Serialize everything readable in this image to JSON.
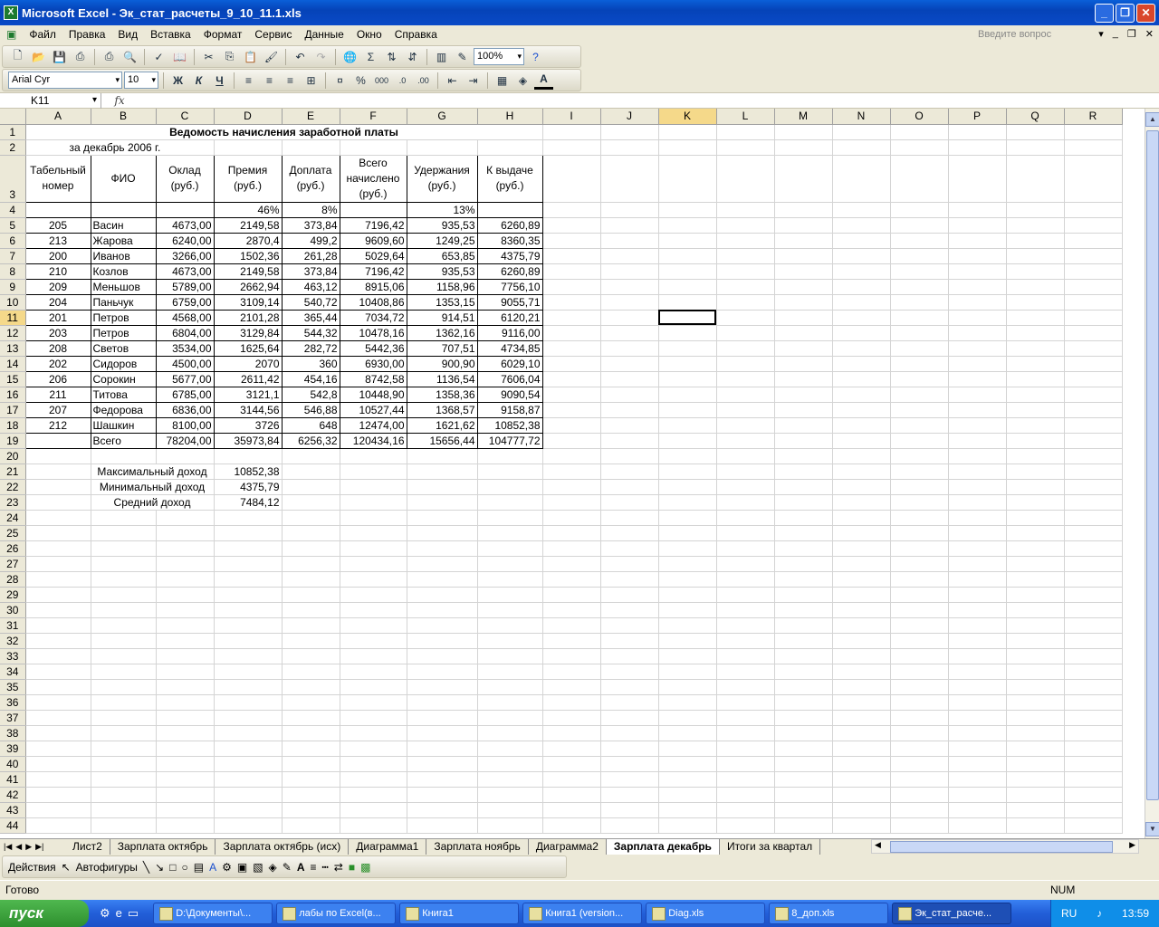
{
  "window": {
    "title": "Microsoft Excel - Эк_стат_расчеты_9_10_11.1.xls"
  },
  "menu": [
    "Файл",
    "Правка",
    "Вид",
    "Вставка",
    "Формат",
    "Сервис",
    "Данные",
    "Окно",
    "Справка"
  ],
  "ask_placeholder": "Введите вопрос",
  "toolbar": {
    "zoom": "100%",
    "font": "Arial Cyr",
    "size": "10",
    "bold": "Ж",
    "italic": "К",
    "underline": "Ч",
    "percent": "%",
    "thousands": "000"
  },
  "formula": {
    "cell_ref": "K11",
    "fx": "fx",
    "content": ""
  },
  "columns": [
    "A",
    "B",
    "C",
    "D",
    "E",
    "F",
    "G",
    "H",
    "I",
    "J",
    "K",
    "L",
    "M",
    "N",
    "O",
    "P",
    "Q",
    "R"
  ],
  "sheet": {
    "title": "Ведомость начисления заработной платы",
    "subtitle": "за декабрь 2006 г.",
    "headers": [
      "Табельный номер",
      "ФИО",
      "Оклад (руб.)",
      "Премия (руб.)",
      "Доплата (руб.)",
      "Всего начислено (руб.)",
      "Удержания (руб.)",
      "К выдаче (руб.)"
    ],
    "rates": {
      "bonus": "46%",
      "extra": "8%",
      "deduct": "13%"
    },
    "rows": [
      [
        "205",
        "Васин",
        "4673,00",
        "2149,58",
        "373,84",
        "7196,42",
        "935,53",
        "6260,89"
      ],
      [
        "213",
        "Жарова",
        "6240,00",
        "2870,4",
        "499,2",
        "9609,60",
        "1249,25",
        "8360,35"
      ],
      [
        "200",
        "Иванов",
        "3266,00",
        "1502,36",
        "261,28",
        "5029,64",
        "653,85",
        "4375,79"
      ],
      [
        "210",
        "Козлов",
        "4673,00",
        "2149,58",
        "373,84",
        "7196,42",
        "935,53",
        "6260,89"
      ],
      [
        "209",
        "Меньшов",
        "5789,00",
        "2662,94",
        "463,12",
        "8915,06",
        "1158,96",
        "7756,10"
      ],
      [
        "204",
        "Паньчук",
        "6759,00",
        "3109,14",
        "540,72",
        "10408,86",
        "1353,15",
        "9055,71"
      ],
      [
        "201",
        "Петров",
        "4568,00",
        "2101,28",
        "365,44",
        "7034,72",
        "914,51",
        "6120,21"
      ],
      [
        "203",
        "Петров",
        "6804,00",
        "3129,84",
        "544,32",
        "10478,16",
        "1362,16",
        "9116,00"
      ],
      [
        "208",
        "Светов",
        "3534,00",
        "1625,64",
        "282,72",
        "5442,36",
        "707,51",
        "4734,85"
      ],
      [
        "202",
        "Сидоров",
        "4500,00",
        "2070",
        "360",
        "6930,00",
        "900,90",
        "6029,10"
      ],
      [
        "206",
        "Сорокин",
        "5677,00",
        "2611,42",
        "454,16",
        "8742,58",
        "1136,54",
        "7606,04"
      ],
      [
        "211",
        "Титова",
        "6785,00",
        "3121,1",
        "542,8",
        "10448,90",
        "1358,36",
        "9090,54"
      ],
      [
        "207",
        "Федорова",
        "6836,00",
        "3144,56",
        "546,88",
        "10527,44",
        "1368,57",
        "9158,87"
      ],
      [
        "212",
        "Шашкин",
        "8100,00",
        "3726",
        "648",
        "12474,00",
        "1621,62",
        "10852,38"
      ]
    ],
    "total": [
      "Всего",
      "78204,00",
      "35973,84",
      "6256,32",
      "120434,16",
      "15656,44",
      "104777,72"
    ],
    "stats": [
      {
        "label": "Максимальный доход",
        "value": "10852,38"
      },
      {
        "label": "Минимальный доход",
        "value": "4375,79"
      },
      {
        "label": "Средний доход",
        "value": "7484,12"
      }
    ]
  },
  "tabs": [
    "Лист2",
    "Зарплата октябрь",
    "Зарплата октябрь (исх)",
    "Диаграмма1",
    "Зарплата ноябрь",
    "Диаграмма2",
    "Зарплата декабрь",
    "Итоги за квартал"
  ],
  "active_tab": "Зарплата декабрь",
  "drawbar": {
    "actions": "Действия",
    "autoshapes": "Автофигуры"
  },
  "status": {
    "text": "Готово",
    "num": "NUM"
  },
  "taskbar": {
    "start": "пуск",
    "tasks": [
      "D:\\Документы\\...",
      "лабы по Excel(в...",
      "Книга1",
      "Книга1 (version...",
      "Diag.xls",
      "8_доп.xls",
      "Эк_стат_расче..."
    ],
    "lang": "RU",
    "time": "13:59"
  }
}
